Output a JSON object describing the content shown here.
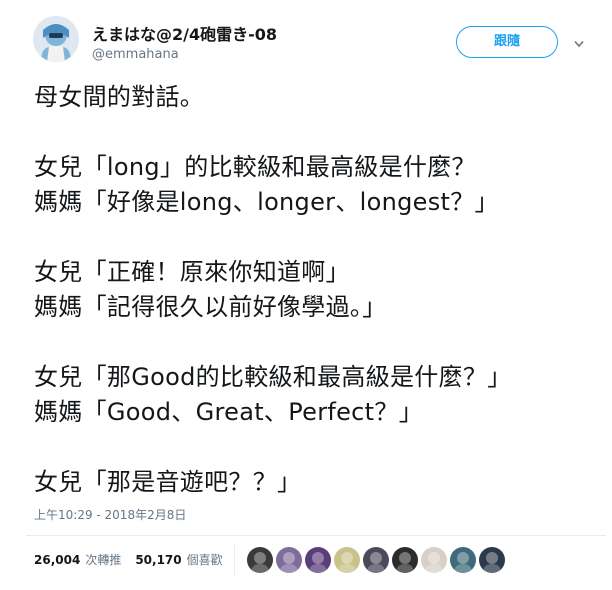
{
  "user": {
    "display_name": "えまはな@2/4砲雷き-08",
    "handle": "@emmahana",
    "avatar_icon": "user-avatar-icon"
  },
  "follow_button": {
    "label": "跟隨"
  },
  "tweet": {
    "lines": [
      "母女間的對話。",
      "",
      "女兒「long」的比較級和最高級是什麼？",
      "媽媽「好像是long、longer、longest？」",
      "",
      "女兒「正確！原來你知道啊」",
      "媽媽「記得很久以前好像學過。」",
      "",
      "女兒「那Good的比較級和最高級是什麼？」",
      "媽媽「Good、Great、Perfect？」",
      "",
      "女兒「那是音遊吧？？」"
    ],
    "timestamp": "上午10:29 - 2018年2月8日"
  },
  "stats": {
    "retweets_count": "26,004",
    "retweets_label": "次轉推",
    "likes_count": "50,170",
    "likes_label": "個喜歡"
  },
  "liker_avatars": [
    {
      "icon": "liker-avatar-icon",
      "color": "#3a3a3a"
    },
    {
      "icon": "liker-avatar-icon",
      "color": "#7e6c9c"
    },
    {
      "icon": "liker-avatar-icon",
      "color": "#5a3d7a"
    },
    {
      "icon": "liker-avatar-icon",
      "color": "#c9c28a"
    },
    {
      "icon": "liker-avatar-icon",
      "color": "#4a4a5a"
    },
    {
      "icon": "liker-avatar-icon",
      "color": "#2c2c2c"
    },
    {
      "icon": "liker-avatar-icon",
      "color": "#d8d0c8"
    },
    {
      "icon": "liker-avatar-icon",
      "color": "#3d6b7a"
    },
    {
      "icon": "liker-avatar-icon",
      "color": "#2a3a4a"
    }
  ],
  "colors": {
    "accent": "#1da1f2",
    "secondary_text": "#657786",
    "primary_text": "#14171a"
  }
}
